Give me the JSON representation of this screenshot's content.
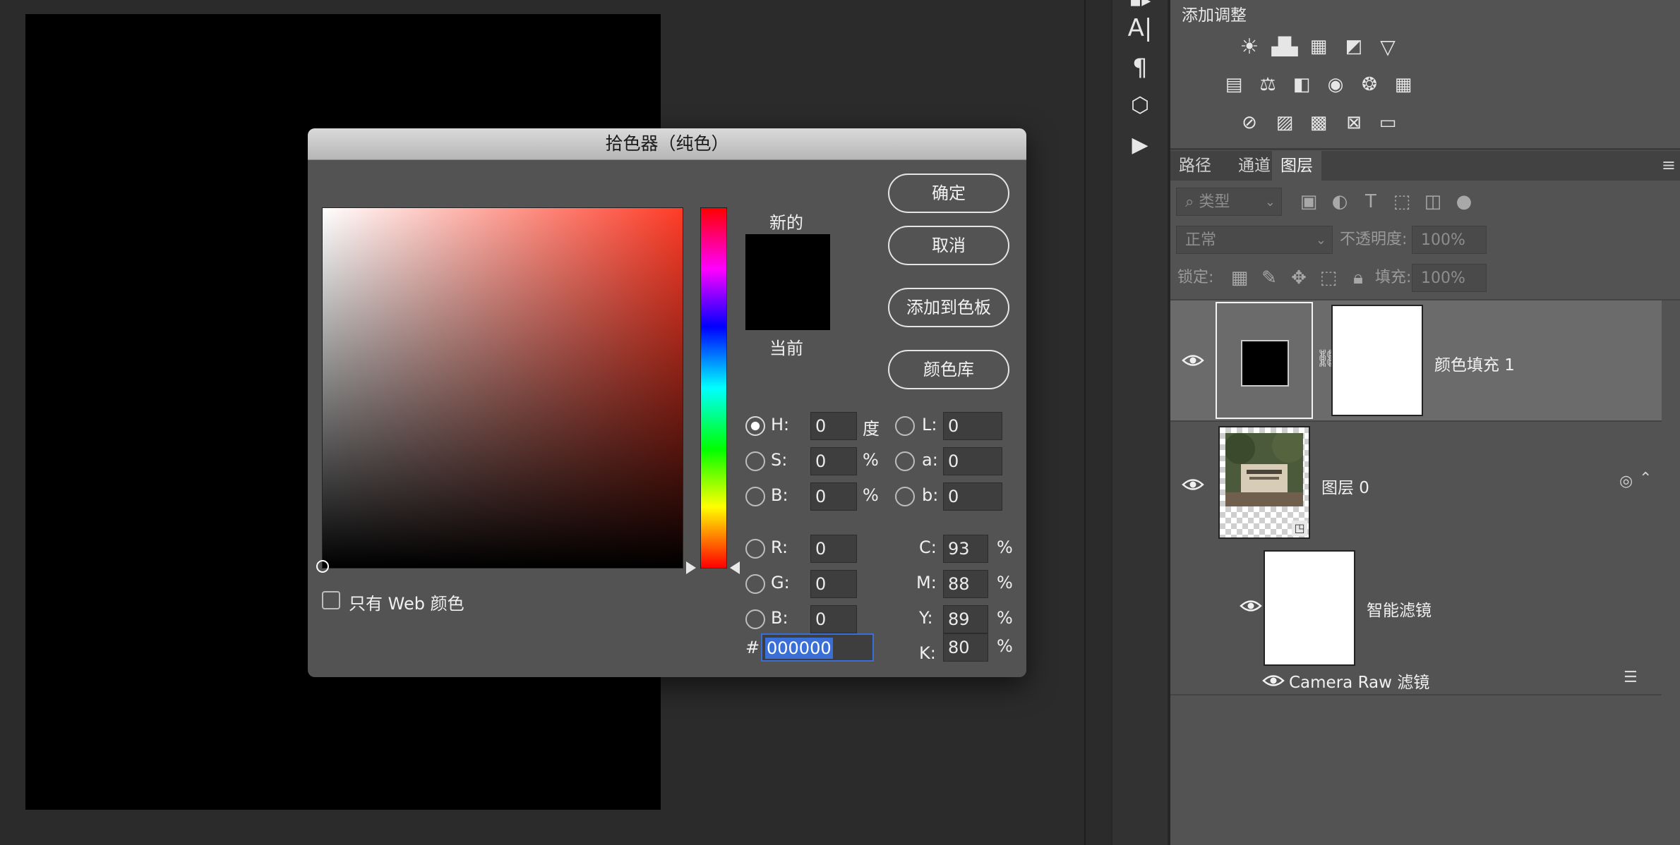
{
  "adjustments": {
    "title": "添加调整"
  },
  "tabs": [
    "路径",
    "通道",
    "图层"
  ],
  "layers_panel": {
    "filter_kind": "类型",
    "blend_mode": "正常",
    "opacity_label": "不透明度:",
    "opacity_value": "100%",
    "lock_label": "锁定:",
    "fill_label": "填充:",
    "fill_value": "100%",
    "layers": [
      {
        "name": "颜色填充 1"
      },
      {
        "name": "图层 0"
      },
      {
        "name": "智能滤镜"
      },
      {
        "name": "Camera Raw 滤镜"
      }
    ]
  },
  "dialog": {
    "title": "拾色器（纯色）",
    "ok": "确定",
    "cancel": "取消",
    "add_to_swatches": "添加到色板",
    "color_libraries": "颜色库",
    "new_label": "新的",
    "current_label": "当前",
    "web_only": "只有 Web 颜色",
    "fields": {
      "H": {
        "label": "H:",
        "value": "0",
        "unit": "度"
      },
      "S": {
        "label": "S:",
        "value": "0",
        "unit": "%"
      },
      "B": {
        "label": "B:",
        "value": "0",
        "unit": "%"
      },
      "R": {
        "label": "R:",
        "value": "0"
      },
      "G": {
        "label": "G:",
        "value": "0"
      },
      "B2": {
        "label": "B:",
        "value": "0"
      },
      "L": {
        "label": "L:",
        "value": "0"
      },
      "a": {
        "label": "a:",
        "value": "0"
      },
      "b": {
        "label": "b:",
        "value": "0"
      },
      "C": {
        "label": "C:",
        "value": "93",
        "unit": "%"
      },
      "M": {
        "label": "M:",
        "value": "88",
        "unit": "%"
      },
      "Y": {
        "label": "Y:",
        "value": "89",
        "unit": "%"
      },
      "K": {
        "label": "K:",
        "value": "80",
        "unit": "%"
      }
    },
    "hex_label": "#",
    "hex_value": "000000"
  },
  "colors": {
    "new_color": "#000000",
    "current_color": "#000000",
    "hue_base": "#ff3b26",
    "selection_highlight": "#3b6fd8"
  }
}
